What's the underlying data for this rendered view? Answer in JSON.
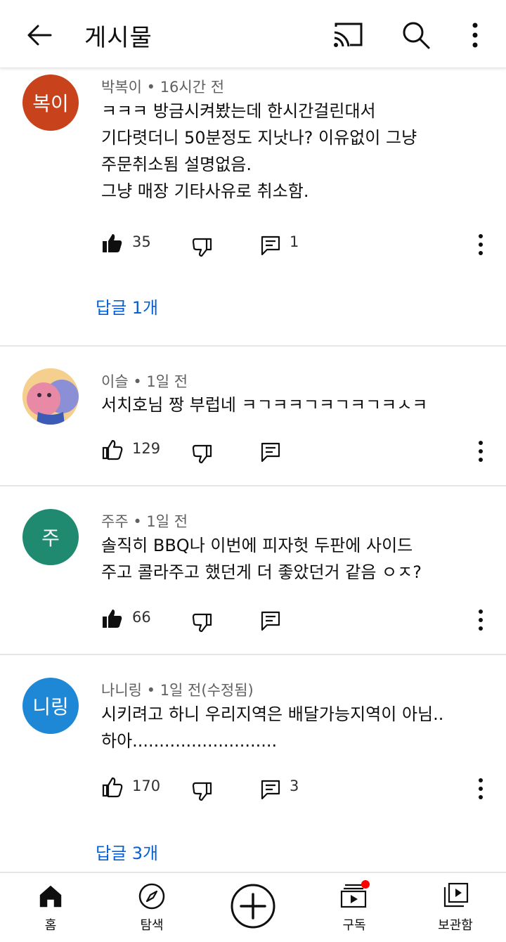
{
  "header": {
    "title": "게시물",
    "icons": [
      "back-arrow-icon",
      "cast-icon",
      "search-icon",
      "more-vert-icon"
    ]
  },
  "comments": [
    {
      "avatar_text": "복이",
      "avatar_color": "#c8421b",
      "author": "박복이",
      "time": "16시간 전",
      "meta": "박복이 • 16시간 전",
      "text": "ㅋㅋㅋ 방금시켜봤는데 한시간걸린대서\n기다렷더니 50분정도 지낫나? 이유없이 그냥\n주문취소됨 설명없음.\n그냥 매장 기타사유로 취소함.",
      "likes": "35",
      "liked": true,
      "replies_count": "1",
      "replies_link": "답글 1개"
    },
    {
      "avatar_text": "",
      "avatar_color": "#d9a0c6",
      "author": "이슬",
      "time": "1일 전",
      "meta": "이슬 • 1일 전",
      "text": "서치호님 짱 부럽네 ㅋㄱㅋㅋㄱㅋㄱㅋㄱㅋㅅㅋ",
      "likes": "129",
      "liked": false,
      "replies_count": "",
      "replies_link": ""
    },
    {
      "avatar_text": "주",
      "avatar_color": "#1f8a70",
      "author": "주주",
      "time": "1일 전",
      "meta": "주주 • 1일 전",
      "text": "솔직히 BBQ나 이번에 피자헛 두판에 사이드\n주고 콜라주고 했던게 더 좋았던거 같음 ㅇㅈ?",
      "likes": "66",
      "liked": true,
      "replies_count": "",
      "replies_link": ""
    },
    {
      "avatar_text": "니링",
      "avatar_color": "#1e88d6",
      "author": "나니링",
      "time": "1일 전(수정됨)",
      "meta": "나니링 • 1일 전(수정됨)",
      "text": "시키려고 하니 우리지역은 배달가능지역이 아님..\n하아...........................",
      "likes": "170",
      "liked": false,
      "replies_count": "3",
      "replies_link": "답글 3개"
    }
  ],
  "bottom_nav": [
    {
      "label": "홈",
      "icon": "home-icon"
    },
    {
      "label": "탐색",
      "icon": "explore-icon"
    },
    {
      "label": "",
      "icon": "create-icon"
    },
    {
      "label": "구독",
      "icon": "subscriptions-icon"
    },
    {
      "label": "보관함",
      "icon": "library-icon"
    }
  ],
  "colors": {
    "link": "#065fd4",
    "notification_dot": "#ff0000"
  }
}
